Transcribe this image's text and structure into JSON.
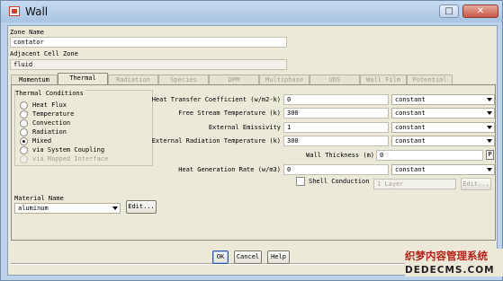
{
  "window": {
    "title": "Wall",
    "maximize_glyph": "□",
    "close_glyph": "✕"
  },
  "zone": {
    "zone_name_label": "Zone Name",
    "zone_name_value": "contator",
    "adjacent_label": "Adjacent Cell Zone",
    "adjacent_value": "fluid"
  },
  "tabs": [
    {
      "label": "Momentum",
      "state": "enabled"
    },
    {
      "label": "Thermal",
      "state": "active"
    },
    {
      "label": "Radiation",
      "state": "disabled"
    },
    {
      "label": "Species",
      "state": "disabled"
    },
    {
      "label": "DPM",
      "state": "disabled"
    },
    {
      "label": "Multiphase",
      "state": "disabled"
    },
    {
      "label": "UDS",
      "state": "disabled"
    },
    {
      "label": "Wall Film",
      "state": "disabled"
    },
    {
      "label": "Potential",
      "state": "disabled"
    }
  ],
  "thermal_conditions": {
    "title": "Thermal Conditions",
    "options": [
      {
        "label": "Heat Flux",
        "checked": false,
        "disabled": false
      },
      {
        "label": "Temperature",
        "checked": false,
        "disabled": false
      },
      {
        "label": "Convection",
        "checked": false,
        "disabled": false
      },
      {
        "label": "Radiation",
        "checked": false,
        "disabled": false
      },
      {
        "label": "Mixed",
        "checked": true,
        "disabled": false
      },
      {
        "label": "via System Coupling",
        "checked": false,
        "disabled": false
      },
      {
        "label": "via Mapped Interface",
        "checked": false,
        "disabled": true
      }
    ]
  },
  "params": {
    "htc_label": "Heat Transfer Coefficient (w/m2-k)",
    "htc_value": "0",
    "htc_method": "constant",
    "fst_label": "Free Stream Temperature (k)",
    "fst_value": "300",
    "fst_method": "constant",
    "emis_label": "External Emissivity",
    "emis_value": "1",
    "emis_method": "constant",
    "ert_label": "External Radiation Temperature (k)",
    "ert_value": "300",
    "ert_method": "constant",
    "wt_label": "Wall Thickness (m)",
    "wt_value": "0",
    "wt_param_btn": "P",
    "hgr_label": "Heat Generation Rate (w/m3)",
    "hgr_value": "0",
    "hgr_method": "constant",
    "shell_label": "Shell Conduction",
    "shell_checked": false,
    "layer_value": "1 Layer",
    "shell_edit": "Edit..."
  },
  "material": {
    "label": "Material Name",
    "value": "aluminum",
    "edit": "Edit..."
  },
  "buttons": {
    "ok": "OK",
    "cancel": "Cancel",
    "help": "Help"
  },
  "watermark": {
    "line1": "织梦内容管理系统",
    "line2": "DEDECMS.COM"
  },
  "colors": {
    "title_bar": "#bcd3ea",
    "panel": "#ece9d8",
    "close_button": "#c7594a",
    "watermark_red": "#b3251a"
  }
}
